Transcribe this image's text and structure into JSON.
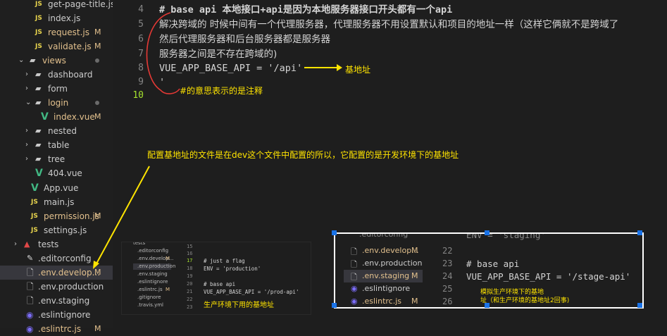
{
  "colors": {
    "annotation": "#ffe400",
    "modified": "#e2c08d",
    "js": "#e8d44d",
    "vue": "#41b883"
  },
  "sidebar": {
    "items": [
      {
        "label": "get-page-title.js",
        "icon": "js",
        "mark": ""
      },
      {
        "label": "index.js",
        "icon": "js",
        "mark": ""
      },
      {
        "label": "request.js",
        "icon": "js",
        "mark": "M"
      },
      {
        "label": "validate.js",
        "icon": "js",
        "mark": "M"
      },
      {
        "label": "views",
        "icon": "folder-open",
        "mark": "dot"
      },
      {
        "label": "dashboard",
        "icon": "folder",
        "mark": ""
      },
      {
        "label": "form",
        "icon": "folder",
        "mark": ""
      },
      {
        "label": "login",
        "icon": "folder-open",
        "mark": "dot"
      },
      {
        "label": "index.vue",
        "icon": "vue",
        "mark": "M"
      },
      {
        "label": "nested",
        "icon": "folder",
        "mark": ""
      },
      {
        "label": "table",
        "icon": "folder",
        "mark": ""
      },
      {
        "label": "tree",
        "icon": "folder",
        "mark": ""
      },
      {
        "label": "404.vue",
        "icon": "vue",
        "mark": ""
      },
      {
        "label": "App.vue",
        "icon": "vue",
        "mark": ""
      },
      {
        "label": "main.js",
        "icon": "js",
        "mark": ""
      },
      {
        "label": "permission.js",
        "icon": "js",
        "mark": "M"
      },
      {
        "label": "settings.js",
        "icon": "js",
        "mark": ""
      },
      {
        "label": "tests",
        "icon": "test-folder",
        "mark": ""
      },
      {
        "label": ".editorconfig",
        "icon": "editorconfig",
        "mark": ""
      },
      {
        "label": ".env.develop...",
        "icon": "file",
        "mark": "M"
      },
      {
        "label": ".env.production",
        "icon": "file",
        "mark": ""
      },
      {
        "label": ".env.staging",
        "icon": "file",
        "mark": ""
      },
      {
        "label": ".eslintignore",
        "icon": "eslint",
        "mark": ""
      },
      {
        "label": ".eslintrc.js",
        "icon": "eslint",
        "mark": "M"
      }
    ]
  },
  "editor": {
    "line_numbers": [
      "4",
      "5",
      "6",
      "7",
      "8",
      "9",
      "10"
    ],
    "lines": [
      "# base api  本地接口+api是因为本地服务器接口开头都有一个api",
      "解决跨域的 时候中间有一个代理服务器，代理服务器不用设置默认和项目的地址一样（这样它俩就不是跨域了",
      "然后代理服务器和后台服务器都是服务器",
      "服务器之间是不存在跨域的)",
      "VUE_APP_BASE_API = '/api'",
      "'",
      ""
    ]
  },
  "annotations": {
    "base_url": "基地址",
    "comment_note": "#的意思表示的是注释",
    "config_note": "配置基地址的文件是在dev这个文件中配置的所以，它配置的是开发环境下的基地址",
    "prod_note": "生产环境下用的基地址",
    "staging_note_1": "模拟生产环境下的基地",
    "staging_note_2": "址（和生产环境的基地址2回事)"
  },
  "inset_production": {
    "files": [
      "tests",
      ".editorconfig",
      ".env.develop...",
      ".env.production",
      ".env.staging",
      ".eslintignore",
      ".eslintrc.js",
      ".gitignore",
      ".travis.yml"
    ],
    "file_mark": "M",
    "line_numbers": [
      "15",
      "16",
      "17",
      "18",
      "19",
      "20",
      "21",
      "22",
      "23"
    ],
    "code": [
      "",
      "",
      "# just a flag",
      "ENV = 'production'",
      "",
      "# base api",
      "VUE_APP_BASE_API = '/prod-api'",
      "",
      ""
    ]
  },
  "inset_staging": {
    "top_partial_left": ".editorconfig",
    "top_partial_right": "ENV = 'staging'",
    "rows": [
      {
        "file": ".env.develop...",
        "mark": "M",
        "num": "22",
        "code": ""
      },
      {
        "file": ".env.production",
        "mark": "",
        "num": "23",
        "code": "# base api"
      },
      {
        "file": ".env.staging",
        "mark": "M",
        "num": "24",
        "code": "VUE_APP_BASE_API = '/stage-api'"
      },
      {
        "file": ".eslintignore",
        "mark": "",
        "num": "25",
        "code": ""
      },
      {
        "file": ".eslintrc.js",
        "mark": "M",
        "num": "26",
        "code": ""
      }
    ]
  }
}
